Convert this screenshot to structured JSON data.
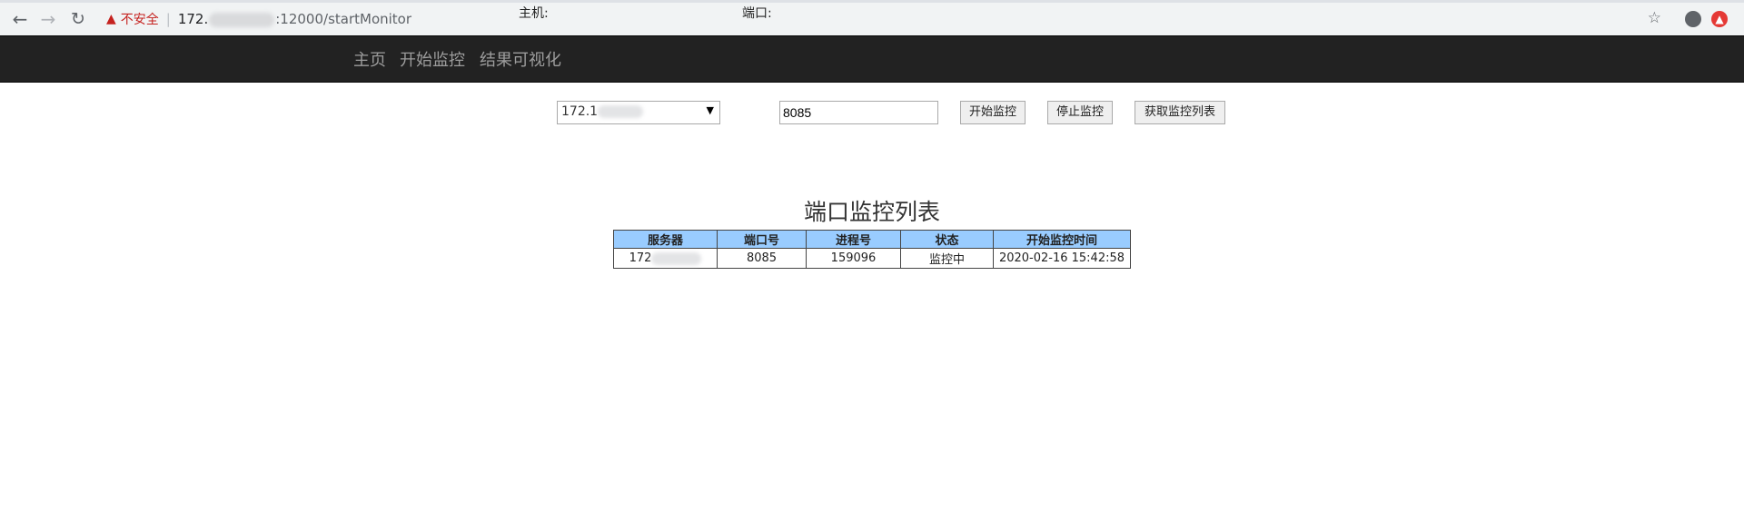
{
  "browser": {
    "insecure_label": "不安全",
    "url_prefix": "172.",
    "url_suffix": ":12000/startMonitor"
  },
  "navbar": {
    "items": [
      "主页",
      "开始监控",
      "结果可视化"
    ]
  },
  "form": {
    "host_label": "主机:",
    "host_value": "172.1",
    "port_label": "端口:",
    "port_value": "8085",
    "start_button": "开始监控",
    "stop_button": "停止监控",
    "list_button": "获取监控列表"
  },
  "table": {
    "title": "端口监控列表",
    "headers": [
      "服务器",
      "端口号",
      "进程号",
      "状态",
      "开始监控时间"
    ],
    "rows": [
      {
        "server": "172",
        "port": "8085",
        "pid": "159096",
        "status": "监控中",
        "start_time": "2020-02-16 15:42:58"
      }
    ]
  }
}
